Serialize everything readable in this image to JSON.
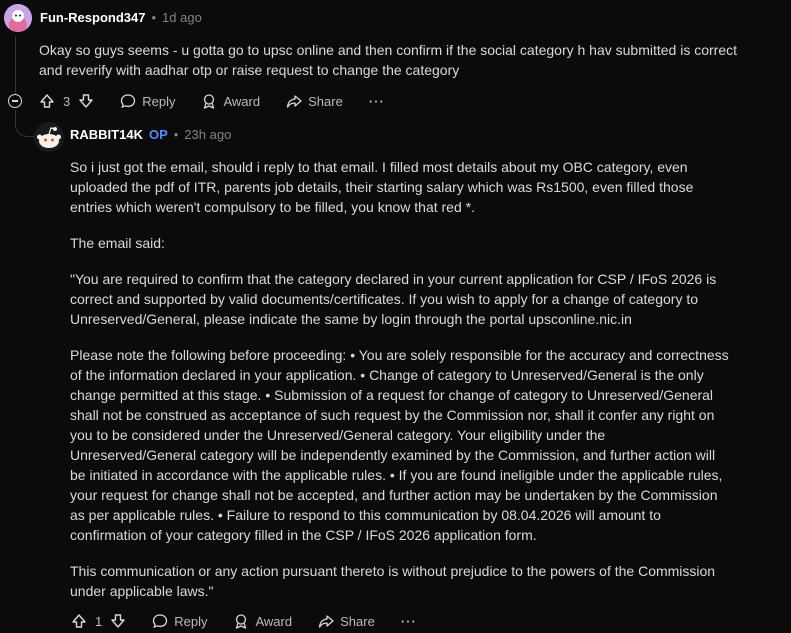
{
  "comment1": {
    "author": "Fun-Respond347",
    "time": "1d ago",
    "body": "Okay so guys seems - u gotta go to upsc online and then confirm if the social category h hav submitted is correct and reverify with aadhar otp or raise request to change the category",
    "votes": "3",
    "reply_label": "Reply",
    "award_label": "Award",
    "share_label": "Share",
    "more_label": "···"
  },
  "comment2": {
    "author": "RABBIT14K",
    "op_badge": "OP",
    "time": "23h ago",
    "paragraphs": [
      "So i just got the email, should i reply to that email. I filled most details about my OBC category, even uploaded the pdf of ITR, parents job details, their starting salary which was Rs1500, even filled those entries which weren't compulsory to be filled, you know that red *.",
      "The email said:",
      "\"You are required to confirm that the category declared in your current application for CSP / IFoS 2026 is correct and supported by valid documents/certificates. If you wish to apply for a change of category to Unreserved/General, please indicate the same by login through the portal upsconline.nic.in",
      "Please note the following before proceeding: • You are solely responsible for the accuracy and correctness of the information declared in your application. • Change of category to Unreserved/General is the only change permitted at this stage. • Submission of a request for change of category to Unreserved/General shall not be construed as acceptance of such request by the Commission nor, shall it confer any right on you to be considered under the Unreserved/General category. Your eligibility under the Unreserved/General category will be independently examined by the Commission, and further action will be initiated in accordance with the applicable rules. • If you are found ineligible under the applicable rules, your request for change shall not be accepted, and further action may be undertaken by the Commission as per applicable rules. • Failure to respond to this communication by 08.04.2026 will amount to confirmation of your category filled in the CSP / IFoS 2026 application form.",
      "This communication or any action pursuant thereto is without prejudice to the powers of the Commission under applicable laws.\""
    ],
    "votes": "1",
    "reply_label": "Reply",
    "award_label": "Award",
    "share_label": "Share",
    "more_label": "···"
  },
  "colors": {
    "background": "#0b0b0b",
    "op_badge": "#4f8cff",
    "text": "#d7dadc",
    "muted": "#818384"
  }
}
